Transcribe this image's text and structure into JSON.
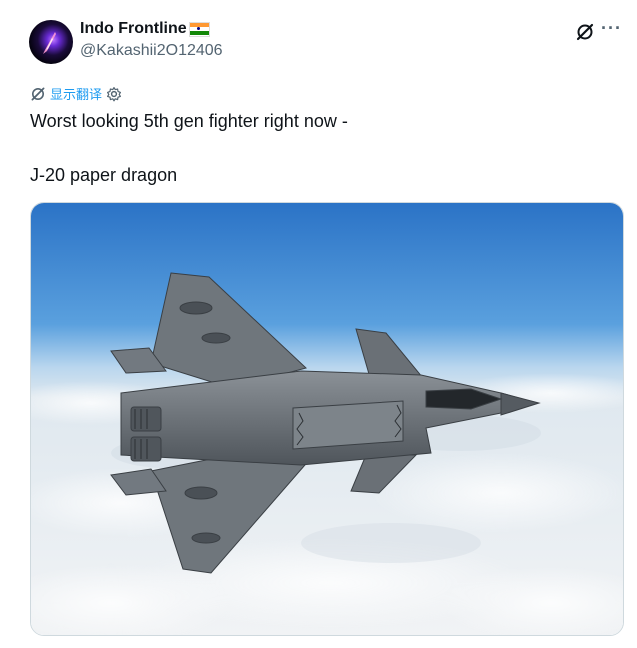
{
  "author": {
    "display_name": "Indo Frontline",
    "handle": "@Kakashii2O12406",
    "flag_icon": "india-flag-icon",
    "flag_colors": [
      "#ff9933",
      "#ffffff",
      "#138808"
    ]
  },
  "header_actions": {
    "grok_icon": "grok-icon",
    "more_icon": "more-horizontal-icon",
    "more_label": "···"
  },
  "translate": {
    "label": "显示翻译",
    "icon": "grok-icon",
    "settings_icon": "gear-icon"
  },
  "post": {
    "line1": "Worst looking 5th gen fighter right now -",
    "line2": "J-20 paper dragon"
  },
  "media": {
    "subject": "fighter-jet-photo",
    "sky_color": "#2d7fcf",
    "cloud_color": "#eef2f5"
  }
}
